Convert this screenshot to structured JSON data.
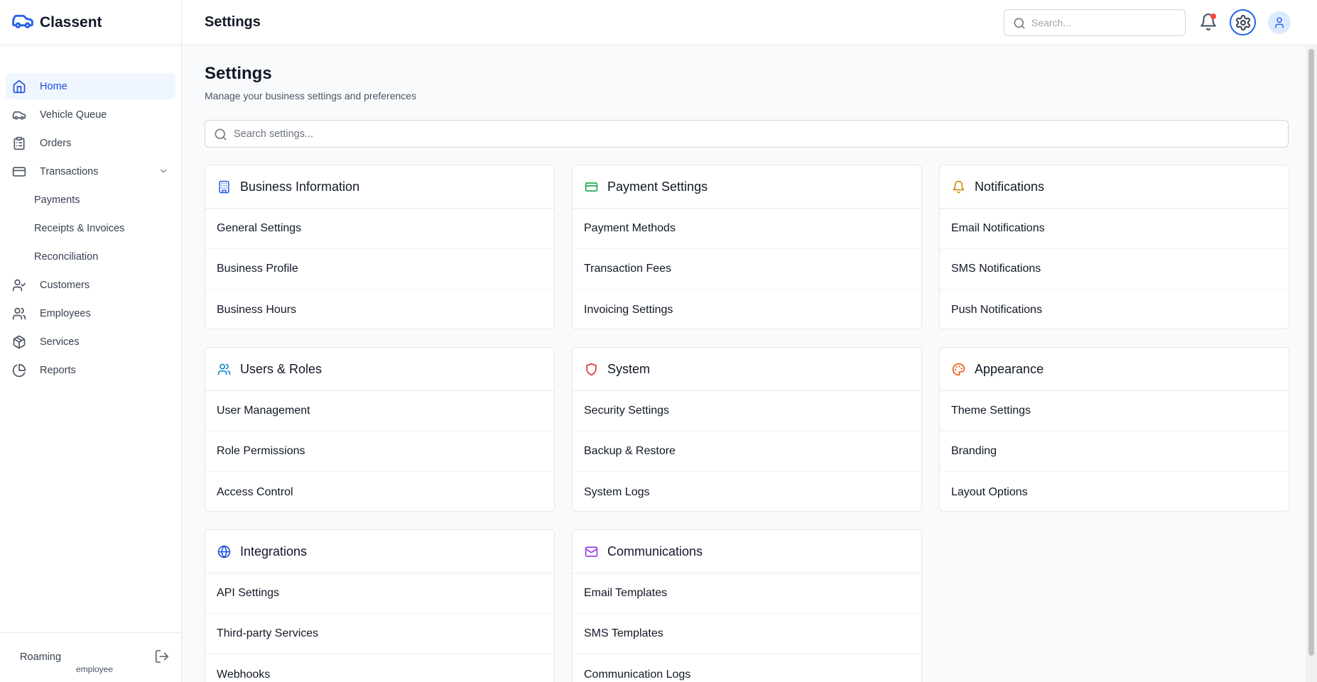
{
  "brand": {
    "name": "Classent",
    "accent": "#2563eb"
  },
  "sidebar": {
    "items": [
      {
        "label": "Home",
        "icon": "home-icon",
        "active": true
      },
      {
        "label": "Vehicle Queue",
        "icon": "car-icon"
      },
      {
        "label": "Orders",
        "icon": "clipboard-icon"
      },
      {
        "label": "Transactions",
        "icon": "credit-card-icon",
        "expanded": true
      },
      {
        "label": "Payments",
        "sub": true
      },
      {
        "label": "Receipts & Invoices",
        "sub": true
      },
      {
        "label": "Reconciliation",
        "sub": true
      },
      {
        "label": "Customers",
        "icon": "user-check-icon"
      },
      {
        "label": "Employees",
        "icon": "users-icon"
      },
      {
        "label": "Services",
        "icon": "package-icon"
      },
      {
        "label": "Reports",
        "icon": "pie-chart-icon"
      }
    ],
    "user": {
      "name": "Roaming",
      "role": "employee"
    }
  },
  "header": {
    "title": "Settings",
    "search_placeholder": "Search..."
  },
  "main": {
    "title": "Settings",
    "subtitle": "Manage your business settings and preferences",
    "search_placeholder": "Search settings...",
    "cards": [
      {
        "title": "Business Information",
        "icon": "building-icon",
        "color": "#2563eb",
        "items": [
          "General Settings",
          "Business Profile",
          "Business Hours"
        ]
      },
      {
        "title": "Payment Settings",
        "icon": "credit-card-icon",
        "color": "#16a34a",
        "items": [
          "Payment Methods",
          "Transaction Fees",
          "Invoicing Settings"
        ]
      },
      {
        "title": "Notifications",
        "icon": "bell-icon",
        "color": "#ca8a04",
        "items": [
          "Email Notifications",
          "SMS Notifications",
          "Push Notifications"
        ]
      },
      {
        "title": "Users & Roles",
        "icon": "users-icon",
        "color": "#0284c7",
        "items": [
          "User Management",
          "Role Permissions",
          "Access Control"
        ]
      },
      {
        "title": "System",
        "icon": "shield-icon",
        "color": "#dc2626",
        "items": [
          "Security Settings",
          "Backup & Restore",
          "System Logs"
        ]
      },
      {
        "title": "Appearance",
        "icon": "palette-icon",
        "color": "#ea580c",
        "items": [
          "Theme Settings",
          "Branding",
          "Layout Options"
        ]
      },
      {
        "title": "Integrations",
        "icon": "globe-icon",
        "color": "#1d4ed8",
        "items": [
          "API Settings",
          "Third-party Services",
          "Webhooks"
        ]
      },
      {
        "title": "Communications",
        "icon": "mail-icon",
        "color": "#9333ea",
        "items": [
          "Email Templates",
          "SMS Templates",
          "Communication Logs"
        ]
      }
    ]
  }
}
